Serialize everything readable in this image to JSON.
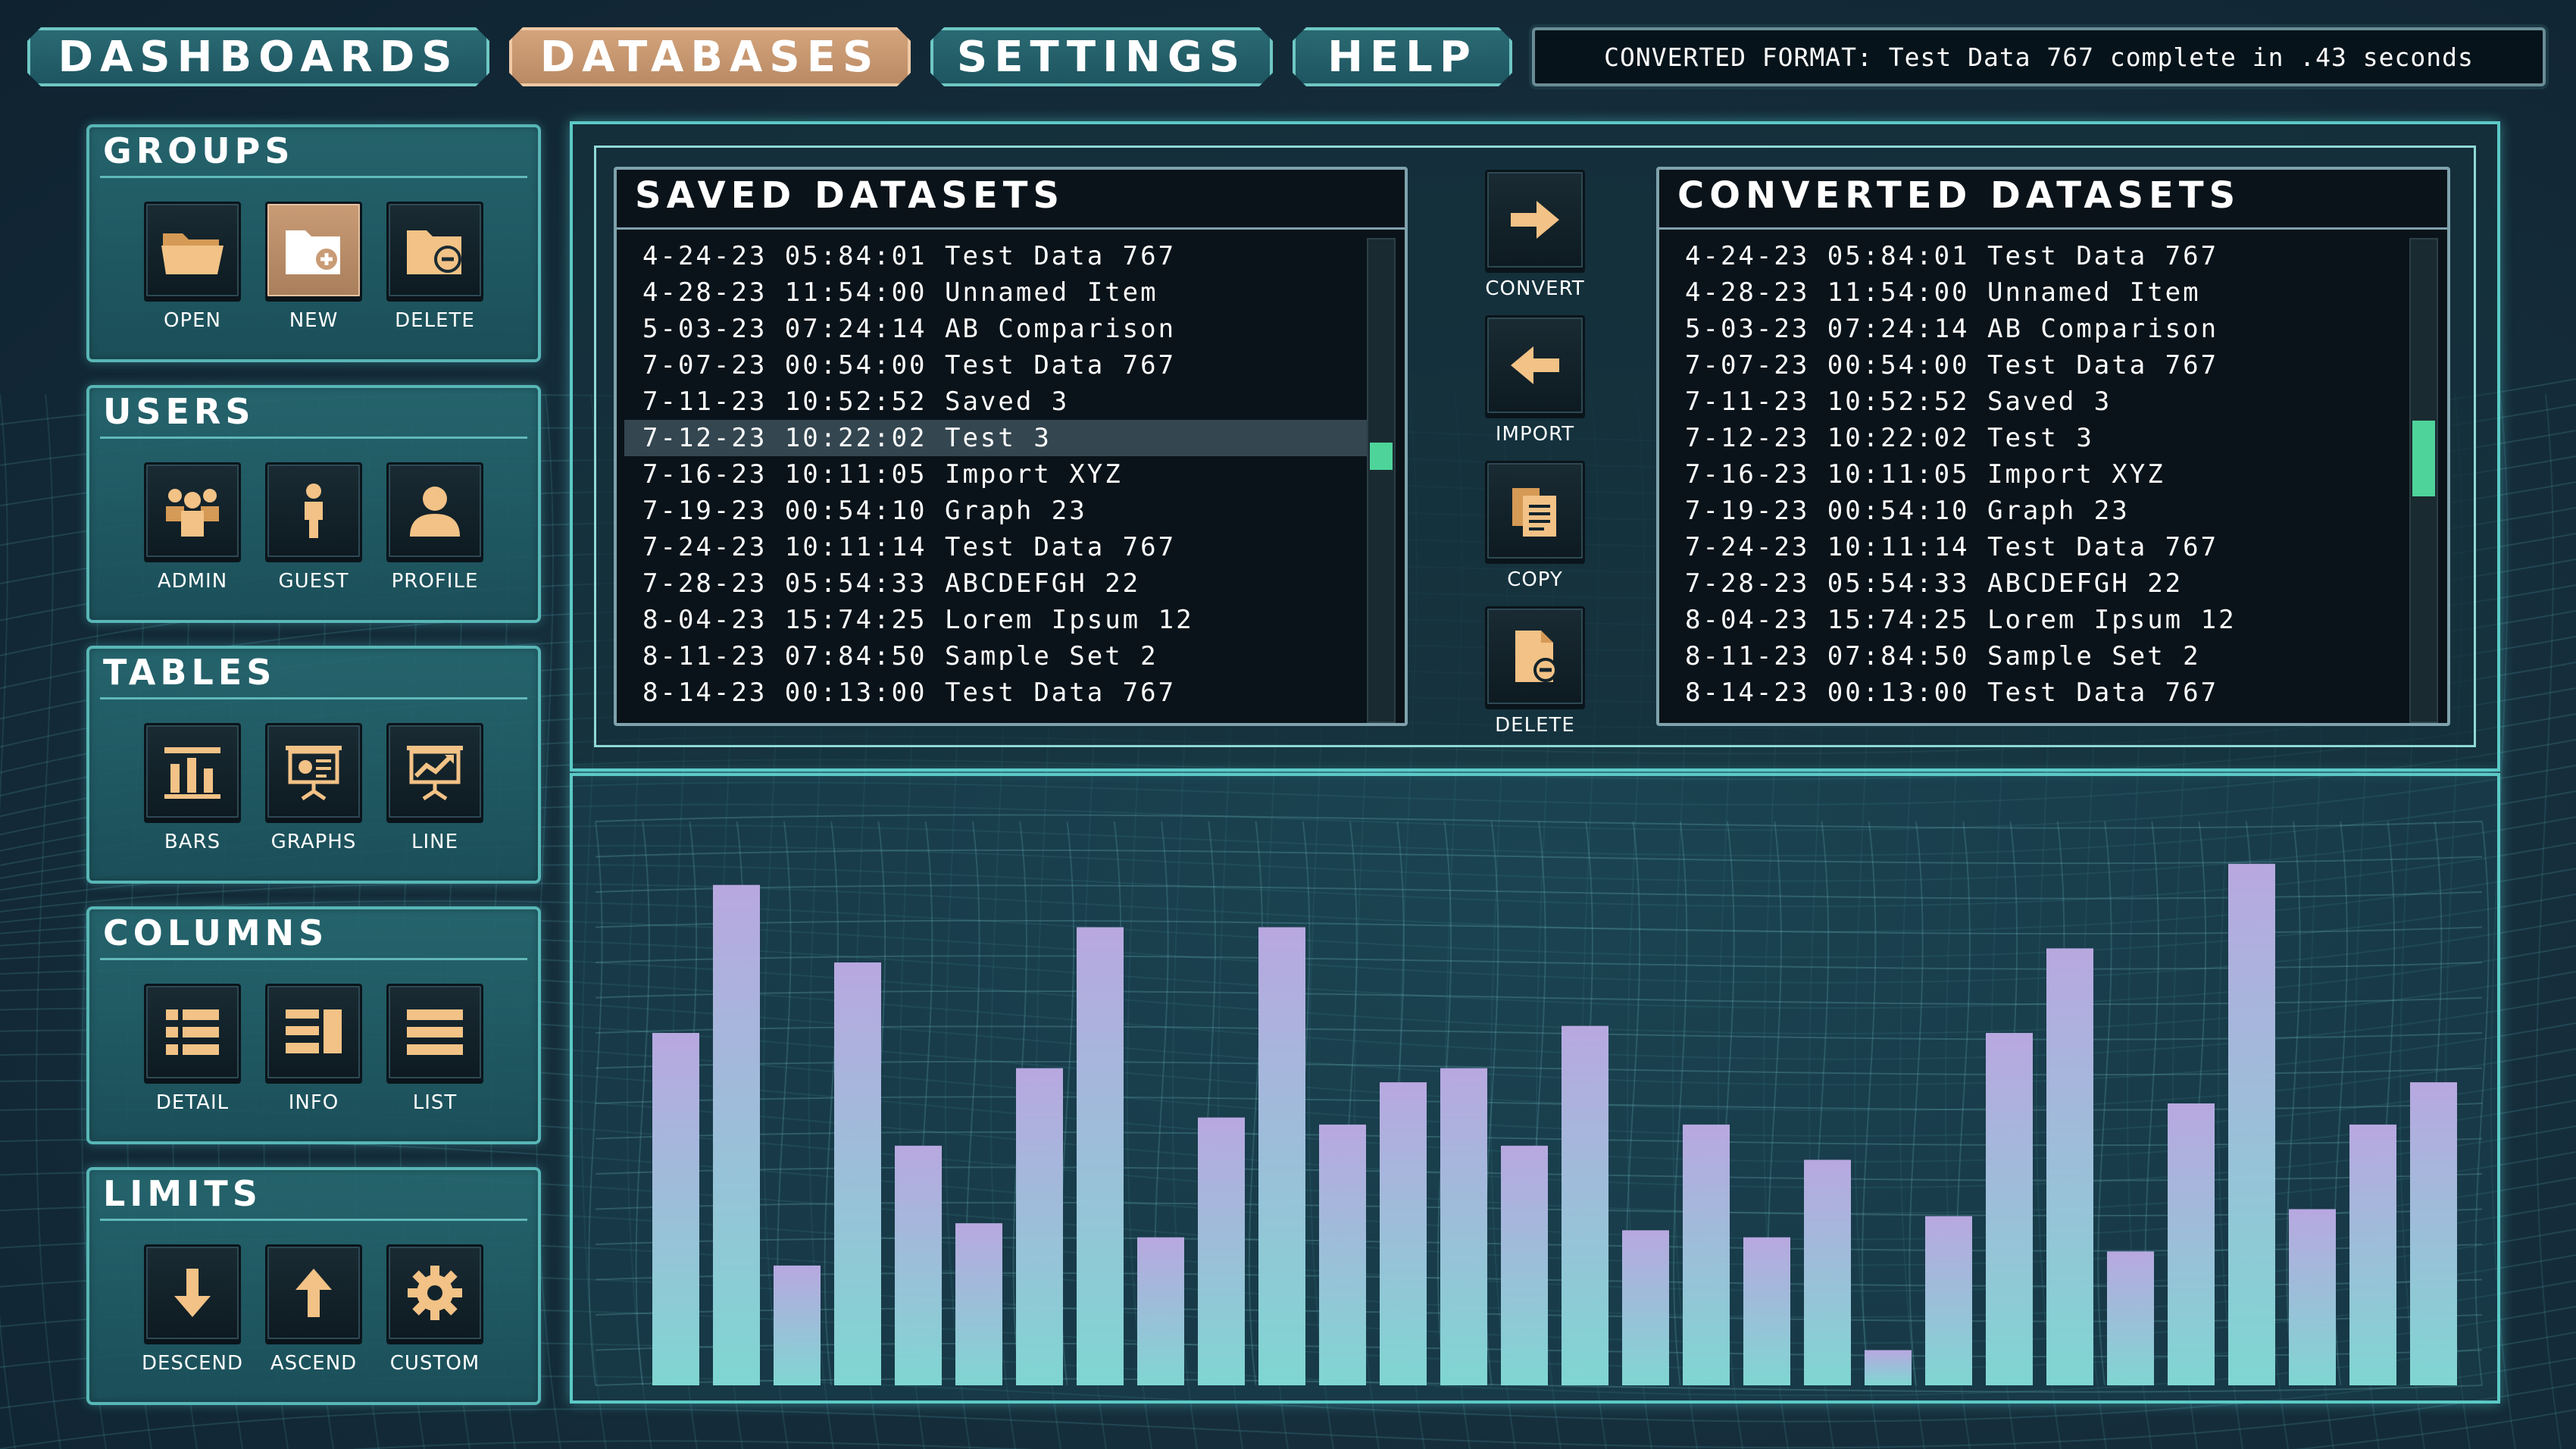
{
  "nav": {
    "tabs": [
      {
        "label": "DASHBOARDS",
        "active": false
      },
      {
        "label": "DATABASES",
        "active": true
      },
      {
        "label": "SETTINGS",
        "active": false
      },
      {
        "label": "HELP",
        "active": false
      }
    ],
    "status": "CONVERTED FORMAT: Test Data 767 complete in .43 seconds"
  },
  "groups": [
    {
      "title": "GROUPS",
      "buttons": [
        {
          "label": "OPEN",
          "icon": "folder-open-icon"
        },
        {
          "label": "NEW",
          "icon": "folder-new-icon",
          "highlight": true
        },
        {
          "label": "DELETE",
          "icon": "folder-delete-icon"
        }
      ]
    },
    {
      "title": "USERS",
      "buttons": [
        {
          "label": "ADMIN",
          "icon": "admin-users-icon"
        },
        {
          "label": "GUEST",
          "icon": "guest-user-icon"
        },
        {
          "label": "PROFILE",
          "icon": "profile-icon"
        }
      ]
    },
    {
      "title": "TABLES",
      "buttons": [
        {
          "label": "BARS",
          "icon": "bar-chart-icon"
        },
        {
          "label": "GRAPHS",
          "icon": "presentation-graph-icon"
        },
        {
          "label": "LINE",
          "icon": "line-chart-icon"
        }
      ]
    },
    {
      "title": "COLUMNS",
      "buttons": [
        {
          "label": "DETAIL",
          "icon": "detail-list-icon"
        },
        {
          "label": "INFO",
          "icon": "info-columns-icon"
        },
        {
          "label": "LIST",
          "icon": "list-icon"
        }
      ]
    },
    {
      "title": "LIMITS",
      "buttons": [
        {
          "label": "DESCEND",
          "icon": "arrow-down-icon"
        },
        {
          "label": "ASCEND",
          "icon": "arrow-up-icon"
        },
        {
          "label": "CUSTOM",
          "icon": "gear-icon"
        }
      ]
    }
  ],
  "saved": {
    "title": "SAVED DATASETS",
    "selected_index": 5,
    "rows": [
      "4-24-23 05:84:01 Test Data 767",
      "4-28-23 11:54:00 Unnamed Item",
      "5-03-23 07:24:14 AB Comparison",
      "7-07-23 00:54:00 Test Data 767",
      "7-11-23 10:52:52 Saved 3",
      "7-12-23 10:22:02 Test 3",
      "7-16-23 10:11:05 Import XYZ",
      "7-19-23 00:54:10 Graph 23",
      "7-24-23 10:11:14 Test Data 767",
      "7-28-23 05:54:33 ABCDEFGH 22",
      "8-04-23 15:74:25 Lorem Ipsum 12",
      "8-11-23 07:84:50 Sample Set 2",
      "8-14-23 00:13:00 Test Data 767"
    ]
  },
  "converted": {
    "title": "CONVERTED DATASETS",
    "rows": [
      "4-24-23 05:84:01 Test Data 767",
      "4-28-23 11:54:00 Unnamed Item",
      "5-03-23 07:24:14 AB Comparison",
      "7-07-23 00:54:00 Test Data 767",
      "7-11-23 10:52:52 Saved 3",
      "7-12-23 10:22:02 Test 3",
      "7-16-23 10:11:05 Import XYZ",
      "7-19-23 00:54:10 Graph 23",
      "7-24-23 10:11:14 Test Data 767",
      "7-28-23 05:54:33 ABCDEFGH 22",
      "8-04-23 15:74:25 Lorem Ipsum 12",
      "8-11-23 07:84:50 Sample Set 2",
      "8-14-23 00:13:00 Test Data 767"
    ]
  },
  "actions": [
    {
      "label": "CONVERT",
      "icon": "arrow-right-icon"
    },
    {
      "label": "IMPORT",
      "icon": "arrow-left-icon"
    },
    {
      "label": "COPY",
      "icon": "copy-documents-icon"
    },
    {
      "label": "DELETE",
      "icon": "document-delete-icon"
    }
  ],
  "scroll_positions": {
    "saved": 0.45,
    "converted": 0.45
  },
  "colors": {
    "accent": "#5cc9c6",
    "highlight": "#c99c76",
    "icon": "#f2c286",
    "scroll_thumb": "#4ed49a",
    "bar_top": "#b8a8e0",
    "bar_bottom": "#7fd6d2"
  },
  "chart_data": {
    "type": "bar",
    "values": [
      50,
      71,
      17,
      60,
      34,
      23,
      45,
      65,
      21,
      38,
      65,
      37,
      43,
      45,
      34,
      51,
      22,
      37,
      21,
      32,
      5,
      24,
      50,
      62,
      19,
      40,
      74,
      25,
      37,
      43
    ],
    "ylim": [
      0,
      80
    ],
    "grid": true,
    "legend": false
  }
}
